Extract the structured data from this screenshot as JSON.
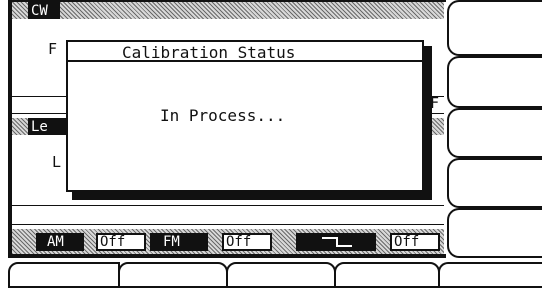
{
  "cw_panel": {
    "title": "CW",
    "freq_label_fragment": "F",
    "freq_label_right_fragment": "F"
  },
  "level_panel": {
    "title_fragment": "Le",
    "value_fragment": "L"
  },
  "dialog": {
    "title": "Calibration Status",
    "message": "In Process..."
  },
  "status_bar": {
    "am_label": "AM",
    "am_state": "Off",
    "fm_label": "FM",
    "fm_state": "Off",
    "pulse_icon": "pulse-waveform-icon",
    "pulse_state": "Off"
  },
  "softkeys": {
    "right": [
      "",
      "",
      "",
      "",
      ""
    ],
    "bottom": [
      "",
      "",
      "",
      "",
      ""
    ]
  },
  "colors": {
    "foreground": "#111111",
    "background": "#ffffff"
  }
}
